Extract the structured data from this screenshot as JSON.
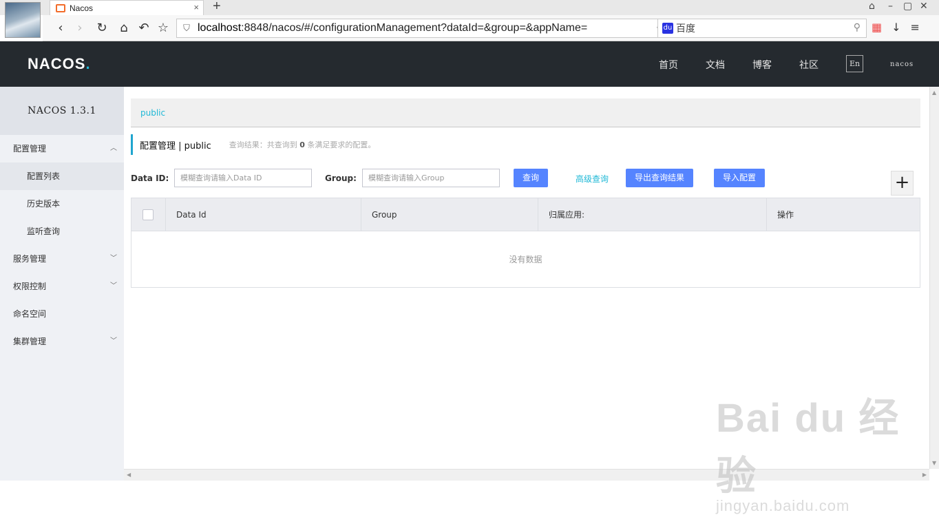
{
  "browser": {
    "tab_title": "Nacos",
    "tab_close": "×",
    "new_tab": "+",
    "url_host": "localhost",
    "url_rest": ":8848/nacos/#/configurationManagement?dataId=&group=&appName=",
    "search_placeholder": "百度"
  },
  "header": {
    "logo_main": "NACOS",
    "logo_dot": ".",
    "menu": [
      "首页",
      "文档",
      "博客",
      "社区"
    ],
    "lang_button": "En",
    "username": "nacos"
  },
  "sidebar": {
    "version": "NACOS 1.3.1",
    "items": [
      {
        "label": "配置管理",
        "arrow": "︿"
      },
      {
        "label": "配置列表"
      },
      {
        "label": "历史版本"
      },
      {
        "label": "监听查询"
      },
      {
        "label": "服务管理",
        "arrow": "﹀"
      },
      {
        "label": "权限控制",
        "arrow": "﹀"
      },
      {
        "label": "命名空间"
      },
      {
        "label": "集群管理",
        "arrow": "﹀"
      }
    ]
  },
  "main": {
    "namespace": "public",
    "title": "配置管理 | public",
    "query_prefix": "查询结果：共查询到",
    "query_count": "0",
    "query_suffix": "条满足要求的配置。",
    "filters": {
      "data_id_label": "Data ID:",
      "data_id_placeholder": "模糊查询请输入Data ID",
      "group_label": "Group:",
      "group_placeholder": "模糊查询请输入Group",
      "search_button": "查询",
      "advanced_link": "高级查询",
      "export_button": "导出查询结果",
      "import_button": "导入配置",
      "add_button": "+"
    },
    "table": {
      "columns": [
        "Data Id",
        "Group",
        "归属应用:",
        "操作"
      ],
      "empty_text": "没有数据"
    }
  },
  "watermark": {
    "big": "Bai du 经验",
    "small": "jingyan.baidu.com"
  },
  "colors": {
    "header_bg": "#252a2f",
    "accent": "#1fb8d6",
    "primary_button": "#5584ff",
    "sidebar_bg": "#eff1f5"
  }
}
